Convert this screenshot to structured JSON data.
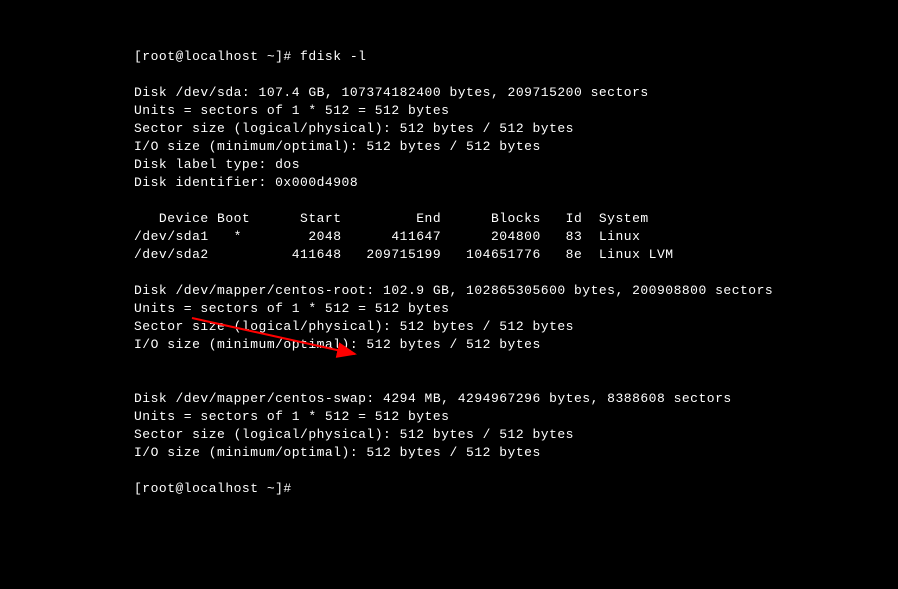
{
  "prompt1": "[root@localhost ~]# fdisk -l",
  "disk_sda": {
    "header": "Disk /dev/sda: 107.4 GB, 107374182400 bytes, 209715200 sectors",
    "units": "Units = sectors of 1 * 512 = 512 bytes",
    "sector": "Sector size (logical/physical): 512 bytes / 512 bytes",
    "io": "I/O size (minimum/optimal): 512 bytes / 512 bytes",
    "label": "Disk label type: dos",
    "ident": "Disk identifier: 0x000d4908"
  },
  "parts": {
    "header": "   Device Boot      Start         End      Blocks   Id  System",
    "row1": "/dev/sda1   *        2048      411647      204800   83  Linux",
    "row2": "/dev/sda2          411648   209715199   104651776   8e  Linux LVM"
  },
  "disk_root": {
    "header": "Disk /dev/mapper/centos-root: 102.9 GB, 102865305600 bytes, 200908800 sectors",
    "units": "Units = sectors of 1 * 512 = 512 bytes",
    "sector": "Sector size (logical/physical): 512 bytes / 512 bytes",
    "io": "I/O size (minimum/optimal): 512 bytes / 512 bytes"
  },
  "disk_swap": {
    "header": "Disk /dev/mapper/centos-swap: 4294 MB, 4294967296 bytes, 8388608 sectors",
    "units": "Units = sectors of 1 * 512 = 512 bytes",
    "sector": "Sector size (logical/physical): 512 bytes / 512 bytes",
    "io": "I/O size (minimum/optimal): 512 bytes / 512 bytes"
  },
  "prompt2": "[root@localhost ~]#",
  "annotation": {
    "color": "#ff0000"
  }
}
